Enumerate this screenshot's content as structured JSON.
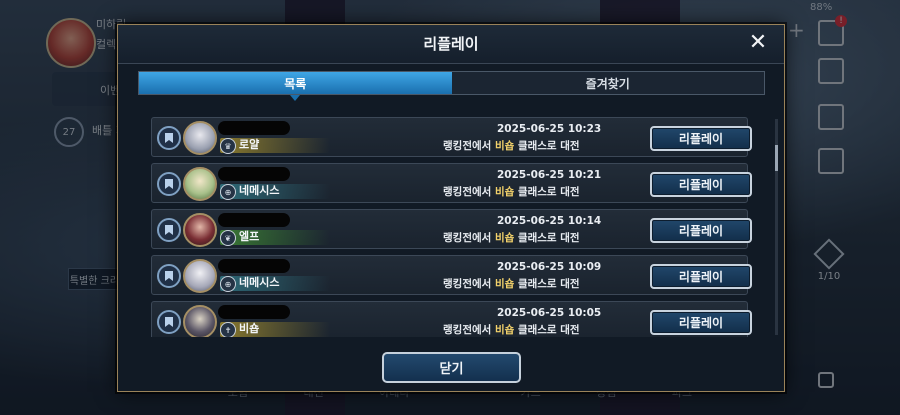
{
  "background": {
    "user_name": "미하릴",
    "user_sub": "컬렉",
    "level": "27",
    "row_labels": [
      "이벤",
      "배틀 패"
    ],
    "special_label": "특별한 크리스",
    "battery": "88%",
    "page_indicator": "1/10",
    "bottom_nav": [
      "모험",
      "대전",
      "아레나",
      "",
      "카드",
      "상점",
      "파크"
    ]
  },
  "modal": {
    "title": "리플레이",
    "close_icon": "close-icon",
    "tabs": [
      {
        "label": "목록",
        "active": true
      },
      {
        "label": "즐겨찾기",
        "active": false
      }
    ],
    "close_button": "닫기"
  },
  "replays": [
    {
      "class_name": "로얄",
      "class_icon": "crown-icon",
      "class_color": "#8a7a2e",
      "datetime": "2025-06-25 10:23",
      "desc_prefix": "랭킹전에서 ",
      "opponent_class": "비숍",
      "desc_suffix": " 클래스로 대전",
      "button": "리플레이"
    },
    {
      "class_name": "네메시스",
      "class_icon": "nemesis-icon",
      "class_color": "#2e6a78",
      "datetime": "2025-06-25 10:21",
      "desc_prefix": "랭킹전에서 ",
      "opponent_class": "비숍",
      "desc_suffix": " 클래스로 대전",
      "button": "리플레이"
    },
    {
      "class_name": "엘프",
      "class_icon": "leaf-icon",
      "class_color": "#3a7a34",
      "datetime": "2025-06-25 10:14",
      "desc_prefix": "랭킹전에서 ",
      "opponent_class": "비숍",
      "desc_suffix": " 클래스로 대전",
      "button": "리플레이"
    },
    {
      "class_name": "네메시스",
      "class_icon": "nemesis-icon",
      "class_color": "#2e6a78",
      "datetime": "2025-06-25 10:09",
      "desc_prefix": "랭킹전에서 ",
      "opponent_class": "비숍",
      "desc_suffix": " 클래스로 대전",
      "button": "리플레이"
    },
    {
      "class_name": "비숍",
      "class_icon": "bishop-icon",
      "class_color": "#8a7a2e",
      "datetime": "2025-06-25 10:05",
      "desc_prefix": "랭킹전에서 ",
      "opponent_class": "비숍",
      "desc_suffix": " 클래스로 대전",
      "button": "리플레이"
    }
  ]
}
